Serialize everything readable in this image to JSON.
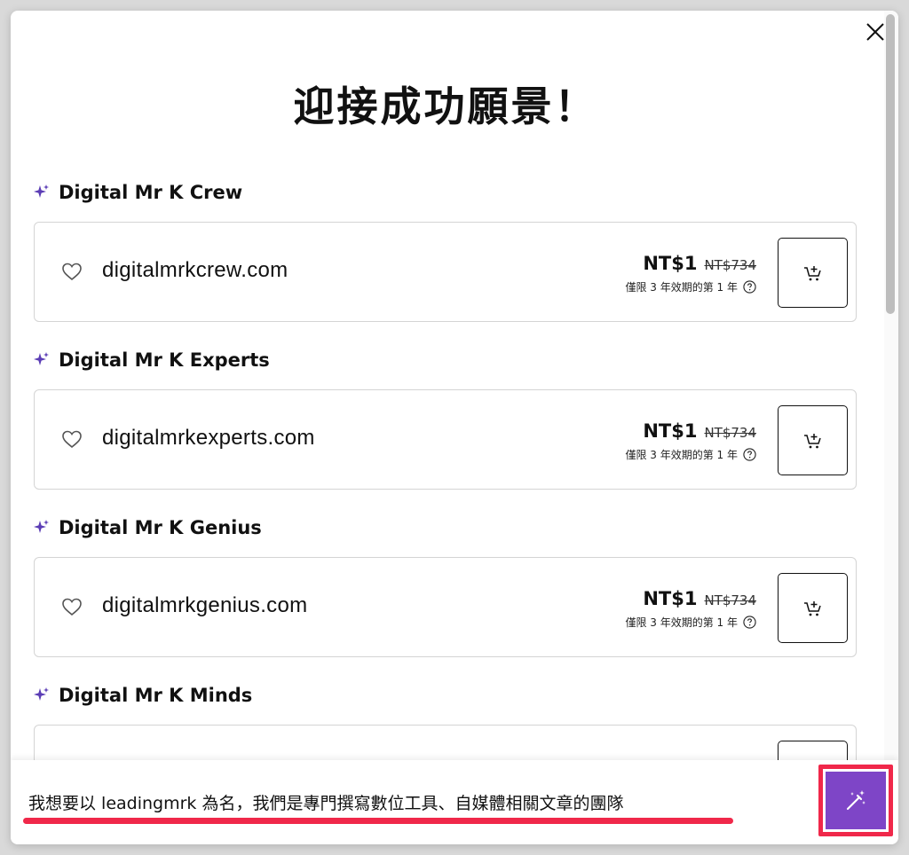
{
  "modal": {
    "title": "迎接成功願景！"
  },
  "suggestions": [
    {
      "group_label": "Digital Mr K Crew",
      "domain": "digitalmrkcrew.com",
      "price": "NT$1",
      "original_price": "NT$734",
      "term": "僅限 3 年效期的第 1 年"
    },
    {
      "group_label": "Digital Mr K Experts",
      "domain": "digitalmrkexperts.com",
      "price": "NT$1",
      "original_price": "NT$734",
      "term": "僅限 3 年效期的第 1 年"
    },
    {
      "group_label": "Digital Mr K Genius",
      "domain": "digitalmrkgenius.com",
      "price": "NT$1",
      "original_price": "NT$734",
      "term": "僅限 3 年效期的第 1 年"
    },
    {
      "group_label": "Digital Mr K Minds"
    }
  ],
  "prompt": {
    "value": "我想要以 leadingmrk 為名，我們是專門撰寫數位工具、自媒體相關文章的團隊"
  },
  "icons": {
    "close": "close-icon",
    "sparkle": "sparkle-icon",
    "heart": "heart-icon",
    "info": "info-icon",
    "cart": "add-to-cart-icon",
    "magic": "magic-wand-icon"
  },
  "colors": {
    "accent_purple": "#7e45c7",
    "annotation_red": "#f0284a",
    "sparkle_purple": "#5b3db5"
  }
}
